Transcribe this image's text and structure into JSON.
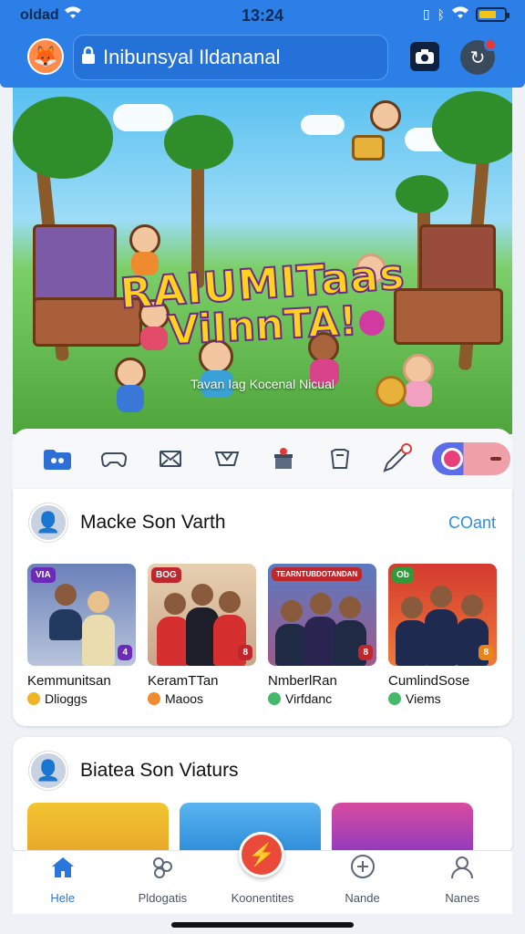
{
  "status_bar": {
    "left": "oldad",
    "time": "13:24"
  },
  "header": {
    "search_text": "Inibunsyal Ildananal",
    "icons": [
      "avatar-icon",
      "lock-icon",
      "camera-icon",
      "notification-icon"
    ]
  },
  "hero": {
    "title_line1": "RAIUMITaas",
    "title_line2": "ViInnTA!",
    "subtitle": "Tavan Iag Kocenal Nicual"
  },
  "categories": {
    "icons": [
      "folder-icon",
      "gamepad-icon",
      "mail-icon",
      "shirt-icon",
      "gift-icon",
      "bag-icon",
      "pen-icon",
      "toggle-switch"
    ]
  },
  "section1": {
    "name": "Macke Son Varth",
    "more": "COant",
    "tiles": [
      {
        "tag": "VIA",
        "corner": "4",
        "title": "Kemmunitsan",
        "sub": "Dlioggs",
        "sub_color": "#f0b429"
      },
      {
        "tag": "BOG",
        "corner": "8",
        "title": "KeramTTan",
        "sub": "Maoos",
        "sub_color": "#f08a2e"
      },
      {
        "tag": "TEARNTUBDOTANDAN",
        "corner": "8",
        "title": "NmberlRan",
        "sub": "Virfdanc",
        "sub_color": "#46b86a"
      },
      {
        "tag": "Ob",
        "corner": "8",
        "title": "CumlindSose",
        "sub": "Viems",
        "sub_color": "#46b86a"
      }
    ]
  },
  "section2": {
    "name": "Biatea Son Viaturs"
  },
  "bottom_nav": {
    "items": [
      {
        "label": "Hele",
        "icon": "home-icon"
      },
      {
        "label": "Pldogatis",
        "icon": "people-icon"
      },
      {
        "label": "Koonentites",
        "icon": "center-action-icon"
      },
      {
        "label": "Nande",
        "icon": "plus-circle-icon"
      },
      {
        "label": "Nanes",
        "icon": "profile-icon"
      }
    ]
  },
  "colors": {
    "brand_blue": "#2b7fe6",
    "accent_red": "#e94a3a",
    "link_blue": "#2f8fdc"
  }
}
